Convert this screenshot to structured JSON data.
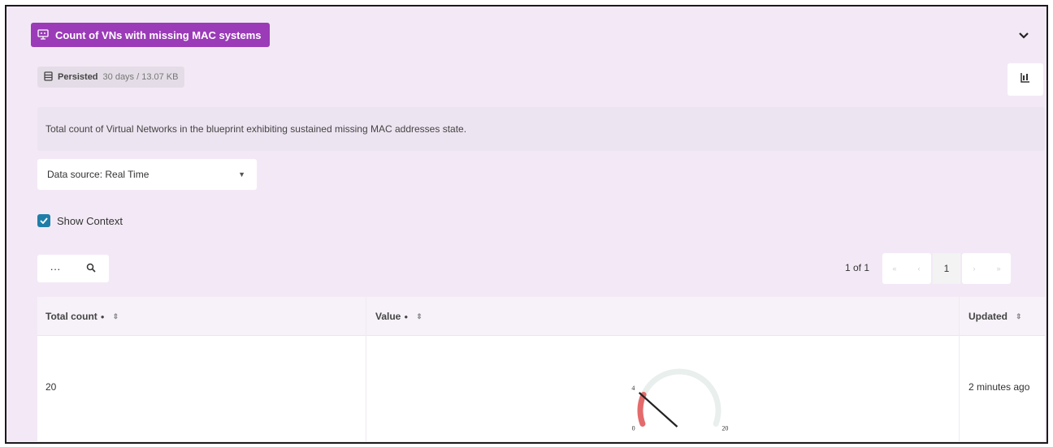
{
  "widget": {
    "title": "Count of VNs with missing MAC systems",
    "persisted_label": "Persisted",
    "persisted_value": "30 days / 13.07 KB",
    "description": "Total count of Virtual Networks in the blueprint exhibiting sustained missing MAC addresses state.",
    "accent_color": "#9b3bb8"
  },
  "data_source": {
    "label": "Data source: Real Time"
  },
  "show_context": {
    "label": "Show Context",
    "checked": true
  },
  "toolbar": {
    "more_icon": "···"
  },
  "pagination": {
    "summary": "1 of 1",
    "current_page": "1"
  },
  "table": {
    "columns": [
      {
        "label": "Total count"
      },
      {
        "label": "Value"
      },
      {
        "label": "Updated"
      }
    ],
    "rows": [
      {
        "total_count": "20",
        "gauge": {
          "min": "0",
          "max": "20",
          "threshold": "4",
          "value": 4
        },
        "updated": "2 minutes ago"
      }
    ]
  }
}
